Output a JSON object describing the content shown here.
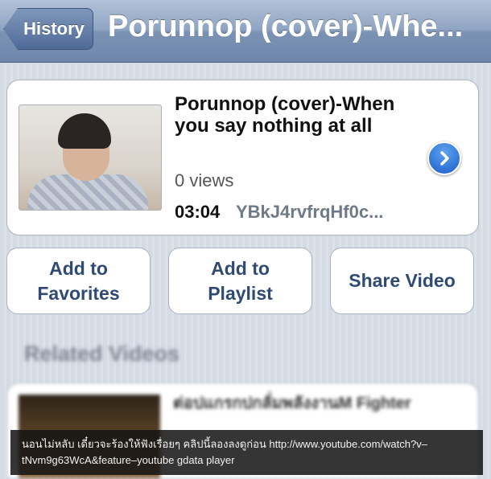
{
  "navbar": {
    "back_label": "History",
    "title": "Porunnop (cover)-Whe..."
  },
  "video": {
    "title": "Porunnop (cover)-When you say nothing at all",
    "views": "0 views",
    "duration": "03:04",
    "video_id": "YBkJ4rvfrqHf0c..."
  },
  "actions": {
    "favorites": "Add to Favorites",
    "playlist": "Add to Playlist",
    "share": "Share Video"
  },
  "related": {
    "header": "Related Videos",
    "first_title": "ต่อปแกรกปกลั่มพลังงานM Fighter"
  },
  "caption": {
    "text": "นอนไม่หลับ เดี๋ยวจะร้องให้ฟังเรื่อยๆ คลิปนี้ลองลงดูก่อน http://www.youtube.com/watch?v–tNvm9g63WcA&feature–youtube  gdata  player"
  },
  "colors": {
    "accent_blue": "#1c5cc9",
    "button_text": "#2f4a73",
    "navbar": "#7b92b4"
  }
}
